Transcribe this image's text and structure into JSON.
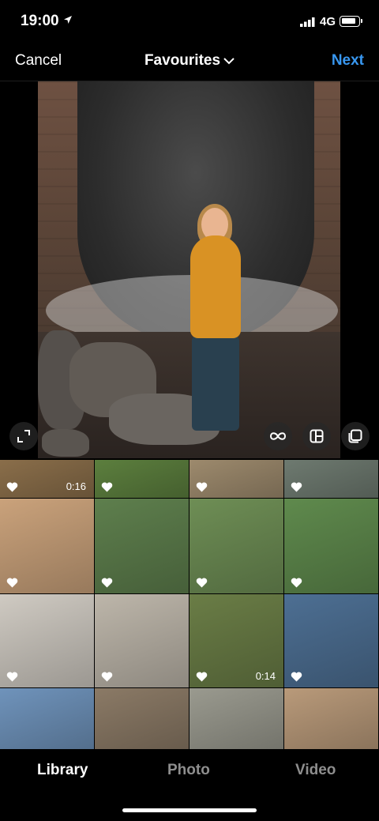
{
  "status": {
    "time": "19:00",
    "network": "4G"
  },
  "header": {
    "cancel": "Cancel",
    "album": "Favourites",
    "next": "Next"
  },
  "preview": {
    "subject": "woman in yellow raincoat in front of mural"
  },
  "controls": [
    "expand-icon",
    "boomerang-icon",
    "layout-icon",
    "multiple-select-icon"
  ],
  "grid": [
    {
      "type": "video",
      "duration": "0:16",
      "bg": "#8a6e4a",
      "fav": true
    },
    {
      "type": "photo",
      "bg": "#5c7f3e",
      "fav": true
    },
    {
      "type": "photo",
      "bg": "#9d8a6d",
      "fav": true
    },
    {
      "type": "photo",
      "bg": "#6e7a70",
      "fav": true
    },
    {
      "type": "photo",
      "bg": "#caa27b",
      "fav": true
    },
    {
      "type": "photo",
      "bg": "#5e7f4d",
      "fav": true
    },
    {
      "type": "photo",
      "bg": "#6e8e55",
      "fav": true
    },
    {
      "type": "photo",
      "bg": "#5f8a4d",
      "fav": true
    },
    {
      "type": "photo",
      "bg": "#cfcac2",
      "fav": true
    },
    {
      "type": "photo",
      "bg": "#bdb6aa",
      "fav": true
    },
    {
      "type": "video",
      "duration": "0:14",
      "bg": "#6a7d46",
      "fav": true
    },
    {
      "type": "photo",
      "bg": "#4d6f93",
      "fav": true
    },
    {
      "type": "photo",
      "bg": "#6f93bb",
      "fav": false
    },
    {
      "type": "photo",
      "bg": "#8b7a66",
      "fav": false
    },
    {
      "type": "photo",
      "bg": "#9a9a8f",
      "fav": false
    },
    {
      "type": "photo",
      "bg": "#b99a7a",
      "fav": false
    }
  ],
  "tabs": {
    "library": "Library",
    "photo": "Photo",
    "video": "Video"
  },
  "colors": {
    "accent": "#3897f0",
    "background": "#000000",
    "inactive_tab": "#8e8e8e"
  }
}
